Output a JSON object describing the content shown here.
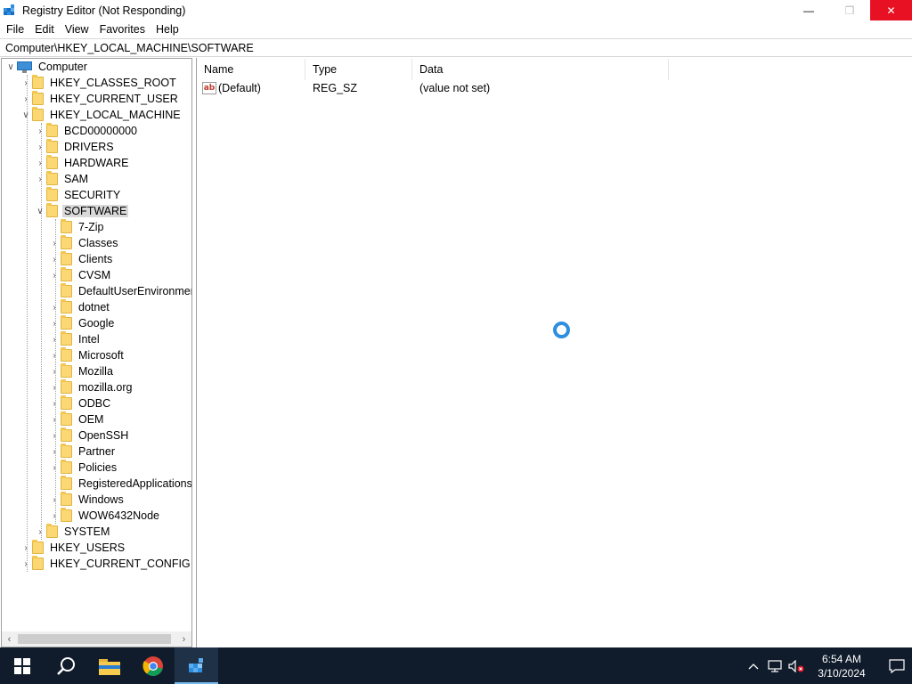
{
  "window": {
    "title": "Registry Editor (Not Responding)",
    "controls": {
      "minimize": "—",
      "maximize": "❐",
      "close": "✕"
    }
  },
  "menu": [
    "File",
    "Edit",
    "View",
    "Favorites",
    "Help"
  ],
  "address": "Computer\\HKEY_LOCAL_MACHINE\\SOFTWARE",
  "tree": {
    "root": "Computer",
    "hives": {
      "classes_root": "HKEY_CLASSES_ROOT",
      "current_user": "HKEY_CURRENT_USER",
      "local_machine": "HKEY_LOCAL_MACHINE",
      "users": "HKEY_USERS",
      "current_config": "HKEY_CURRENT_CONFIG"
    },
    "hklm_children": {
      "bcd": "BCD00000000",
      "drivers": "DRIVERS",
      "hardware": "HARDWARE",
      "sam": "SAM",
      "security": "SECURITY",
      "software": "SOFTWARE",
      "system": "SYSTEM"
    },
    "software_children": [
      "7-Zip",
      "Classes",
      "Clients",
      "CVSM",
      "DefaultUserEnvironmen",
      "dotnet",
      "Google",
      "Intel",
      "Microsoft",
      "Mozilla",
      "mozilla.org",
      "ODBC",
      "OEM",
      "OpenSSH",
      "Partner",
      "Policies",
      "RegisteredApplications",
      "Windows",
      "WOW6432Node"
    ],
    "selected": "SOFTWARE"
  },
  "list": {
    "columns": [
      "Name",
      "Type",
      "Data"
    ],
    "rows": [
      {
        "name": "(Default)",
        "type": "REG_SZ",
        "data": "(value not set)",
        "icon": "ab"
      }
    ]
  },
  "taskbar": {
    "apps": [
      "start-icon",
      "search-icon",
      "file-explorer-icon",
      "chrome-icon",
      "regedit-icon"
    ],
    "active_app": "regedit-icon",
    "clock": {
      "time": "6:54 AM",
      "date": "3/10/2024"
    }
  },
  "colors": {
    "accent": "#2e8fe0",
    "close_button": "#e81123",
    "taskbar": "#101c2c",
    "folder": "#fbd873"
  }
}
